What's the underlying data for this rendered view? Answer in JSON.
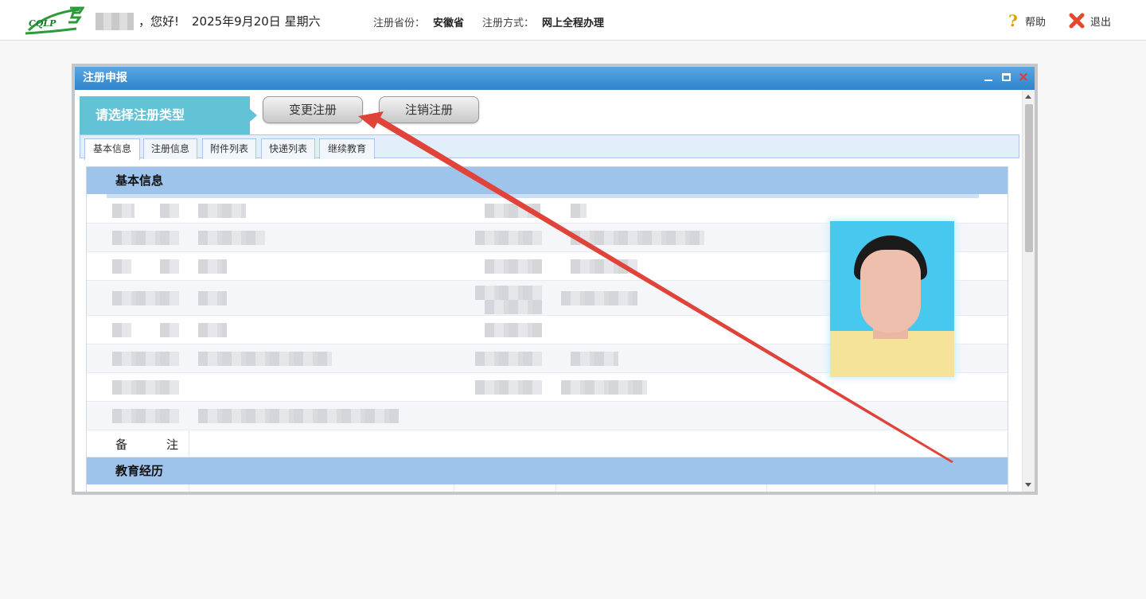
{
  "header": {
    "logo_text": "CQLP",
    "greeting": "，您好!",
    "date": "2025年9月20日 星期六",
    "province_label": "注册省份：",
    "province_value": "安徽省",
    "method_label": "注册方式：",
    "method_value": "网上全程办理",
    "help_label": "帮助",
    "logout_label": "退出"
  },
  "window": {
    "title": "注册申报",
    "selector_label": "请选择注册类型",
    "buttons": {
      "change": "变更注册",
      "cancel": "注销注册"
    },
    "tabs": [
      {
        "label": "基本信息",
        "active": true
      },
      {
        "label": "注册信息",
        "active": false
      },
      {
        "label": "附件列表",
        "active": false
      },
      {
        "label": "快递列表",
        "active": false
      },
      {
        "label": "继续教育",
        "active": false
      }
    ],
    "sections": {
      "basic_info": "基本信息",
      "remark_label_left": "备",
      "remark_label_right": "注",
      "education": "教育经历"
    }
  },
  "colors": {
    "title_bar": "#2f84cc",
    "selector": "#63c3d6",
    "section_header": "#9fc4ec",
    "annotation_arrow": "#e0433a"
  },
  "icons": {
    "help": "question-mark-icon",
    "logout": "red-x-icon",
    "minimize": "minimize-icon",
    "maximize": "maximize-icon",
    "close": "close-icon"
  }
}
